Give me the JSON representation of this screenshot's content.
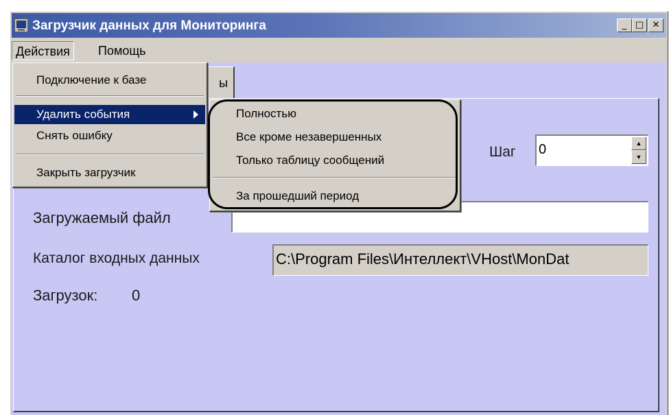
{
  "window": {
    "title": "Загрузчик данных для Мониторинга",
    "controls": {
      "minimize": "_",
      "maximize": "□",
      "close": "✕"
    }
  },
  "menubar": {
    "items": [
      "Действия",
      "Помощь"
    ]
  },
  "actions_menu": {
    "items": [
      {
        "label": "Подключение к базе"
      },
      {
        "label": "Удалить события",
        "has_submenu": true,
        "selected": true
      },
      {
        "label": "Снять ошибку"
      },
      {
        "label": "Закрыть загрузчик"
      }
    ]
  },
  "delete_submenu": {
    "items": [
      {
        "label": "Полностью"
      },
      {
        "label": "Все кроме незавершенных"
      },
      {
        "label": "Только таблицу сообщений"
      },
      {
        "label": "За прошедший период"
      }
    ]
  },
  "tab": {
    "label_fragment": "ы"
  },
  "form": {
    "step_label": "Шаг",
    "step_value": "0",
    "file_label": "Загружаемый файл",
    "file_value": "",
    "catalog_label": "Каталог входных данных",
    "catalog_value": "C:\\Program Files\\Интеллект\\VHost\\MonDat",
    "loads_label": "Загрузок:",
    "loads_value": "0"
  },
  "colors": {
    "title_gradient_start": "#3d5aa6",
    "content_bg": "#c9c8f4",
    "selection": "#0a246a",
    "window_bg": "#d4d0c8"
  }
}
